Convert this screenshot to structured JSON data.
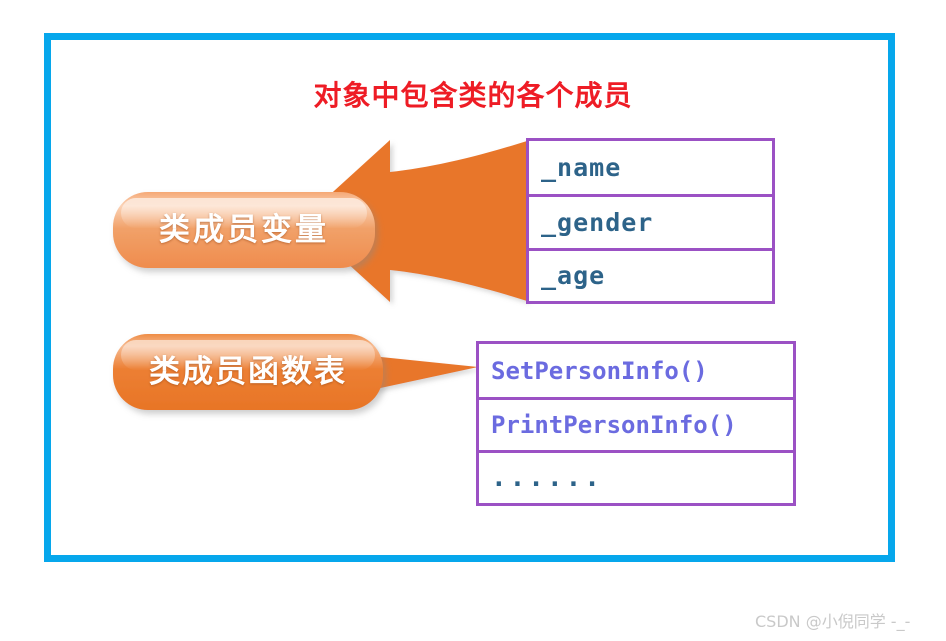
{
  "diagram": {
    "title": "对象中包含类的各个成员",
    "title_color": "#ee1c25",
    "frame_color": "#06a7ec",
    "background": "#ffffff"
  },
  "labels": [
    {
      "id": "class-member-variables",
      "text": "类成员变量",
      "fill_from": "#f8c3a0",
      "fill_to": "#ef8344",
      "text_color": "#ffffff"
    },
    {
      "id": "class-member-function-table",
      "text": "类成员函数表",
      "fill_from": "#f3a36a",
      "fill_to": "#ec7c2d",
      "text_color": "#ffffff"
    }
  ],
  "connectors": [
    {
      "id": "big-arrow",
      "shape": "left-pointing-block-arrow",
      "color": "#e8762c",
      "from": "class-member-variables",
      "to": "member-variables-table"
    },
    {
      "id": "thin-arrow",
      "shape": "right-pointing-tapered-triangle",
      "color": "#e8762c",
      "from": "class-member-function-table",
      "to": "member-functions-table"
    }
  ],
  "tables": {
    "member_variables": {
      "id": "member-variables-table",
      "border_color": "#9b51c4",
      "text_color": "#2d6389",
      "rows": [
        "_name",
        "_gender",
        "_age"
      ]
    },
    "member_functions": {
      "id": "member-functions-table",
      "border_color": "#9b51c4",
      "text_color": "#6b6be0",
      "rows": [
        "SetPersonInfo()",
        "PrintPersonInfo()",
        "......"
      ]
    }
  },
  "watermark": {
    "text": "CSDN @小倪同学 -_-",
    "color": "#c9c9c9"
  }
}
